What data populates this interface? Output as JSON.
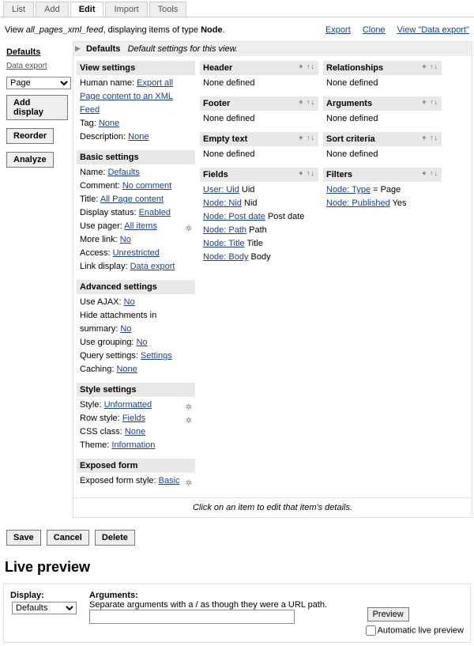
{
  "tabs": {
    "list": "List",
    "add": "Add",
    "edit": "Edit",
    "import": "Import",
    "tools": "Tools"
  },
  "top": {
    "view_prefix": "View ",
    "view_name": "all_pages_xml_feed",
    "view_mid": ", displaying items of type ",
    "view_type": "Node",
    "view_suf": ".",
    "export": "Export",
    "clone": "Clone",
    "view_link": "View \"Data export\""
  },
  "sidebar": {
    "defaults": "Defaults",
    "data_export": "Data export",
    "page_sel": "Page",
    "add_display": "Add display",
    "reorder": "Reorder",
    "analyze": "Analyze"
  },
  "main": {
    "defaults_label": "Defaults",
    "defaults_note": "Default settings for this view.",
    "footline": "Click on an item to edit that item's details."
  },
  "col1": {
    "view": {
      "title": "View settings",
      "hname_k": "Human name:",
      "hname_v": "Export all Page content to an XML Feed",
      "tag_k": "Tag:",
      "tag_v": "None",
      "desc_k": "Description:",
      "desc_v": "None"
    },
    "basic": {
      "title": "Basic settings",
      "name_k": "Name:",
      "name_v": "Defaults",
      "comment_k": "Comment:",
      "comment_v": "No comment",
      "titl_k": "Title:",
      "titl_v": "All Page content",
      "disp_k": "Display status:",
      "disp_v": "Enabled",
      "pager_k": "Use pager:",
      "pager_v": "All items",
      "more_k": "More link:",
      "more_v": "No",
      "acc_k": "Access:",
      "acc_v": "Unrestricted",
      "ld_k": "Link display:",
      "ld_v": "Data export"
    },
    "adv": {
      "title": "Advanced settings",
      "ajax_k": "Use AJAX:",
      "ajax_v": "No",
      "hide_k": "Hide attachments in summary:",
      "hide_v": "No",
      "grp_k": "Use grouping:",
      "grp_v": "No",
      "qs_k": "Query settings:",
      "qs_v": "Settings",
      "cache_k": "Caching:",
      "cache_v": "None"
    },
    "style": {
      "title": "Style settings",
      "style_k": "Style:",
      "style_v": "Unformatted",
      "row_k": "Row style:",
      "row_v": "Fields",
      "css_k": "CSS class:",
      "css_v": "None",
      "theme_k": "Theme:",
      "theme_v": "Information"
    },
    "exposed": {
      "title": "Exposed form",
      "ef_k": "Exposed form style:",
      "ef_v": "Basic"
    }
  },
  "col2": {
    "header": {
      "title": "Header",
      "none": "None defined"
    },
    "footer": {
      "title": "Footer",
      "none": "None defined"
    },
    "empty": {
      "title": "Empty text",
      "none": "None defined"
    },
    "fields": {
      "title": "Fields",
      "r1a": "User: Uid",
      "r1b": "Uid",
      "r2a": "Node: Nid",
      "r2b": "Nid",
      "r3a": "Node: Post date",
      "r3b": "Post date",
      "r4a": "Node: Path",
      "r4b": "Path",
      "r5a": "Node: Title",
      "r5b": "Title",
      "r6a": "Node: Body",
      "r6b": "Body"
    }
  },
  "col3": {
    "rel": {
      "title": "Relationships",
      "none": "None defined"
    },
    "arg": {
      "title": "Arguments",
      "none": "None defined"
    },
    "sort": {
      "title": "Sort criteria",
      "none": "None defined"
    },
    "filt": {
      "title": "Filters",
      "r1a": "Node: Type",
      "r1b": " = Page",
      "r2a": "Node: Published",
      "r2b": " Yes"
    }
  },
  "actions": {
    "save": "Save",
    "cancel": "Cancel",
    "delete": "Delete"
  },
  "preview": {
    "heading": "Live preview",
    "display": "Display:",
    "display_val": "Defaults",
    "args": "Arguments:",
    "args_help": "Separate arguments with a / as though they were a URL path.",
    "preview_btn": "Preview",
    "auto": "Automatic live preview"
  }
}
